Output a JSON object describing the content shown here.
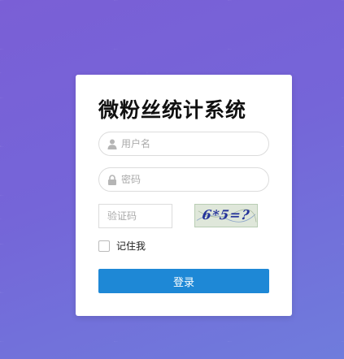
{
  "login": {
    "title": "微粉丝统计系统",
    "username": {
      "placeholder": "用户名",
      "icon": "user-icon"
    },
    "password": {
      "placeholder": "密码",
      "icon": "lock-icon"
    },
    "captcha": {
      "placeholder": "验证码",
      "image_text": "6*5=?"
    },
    "remember_label": "记住我",
    "submit_label": "登录"
  },
  "colors": {
    "background": "#7565d8",
    "button": "#1e88d6",
    "captcha_text": "#23329a"
  }
}
